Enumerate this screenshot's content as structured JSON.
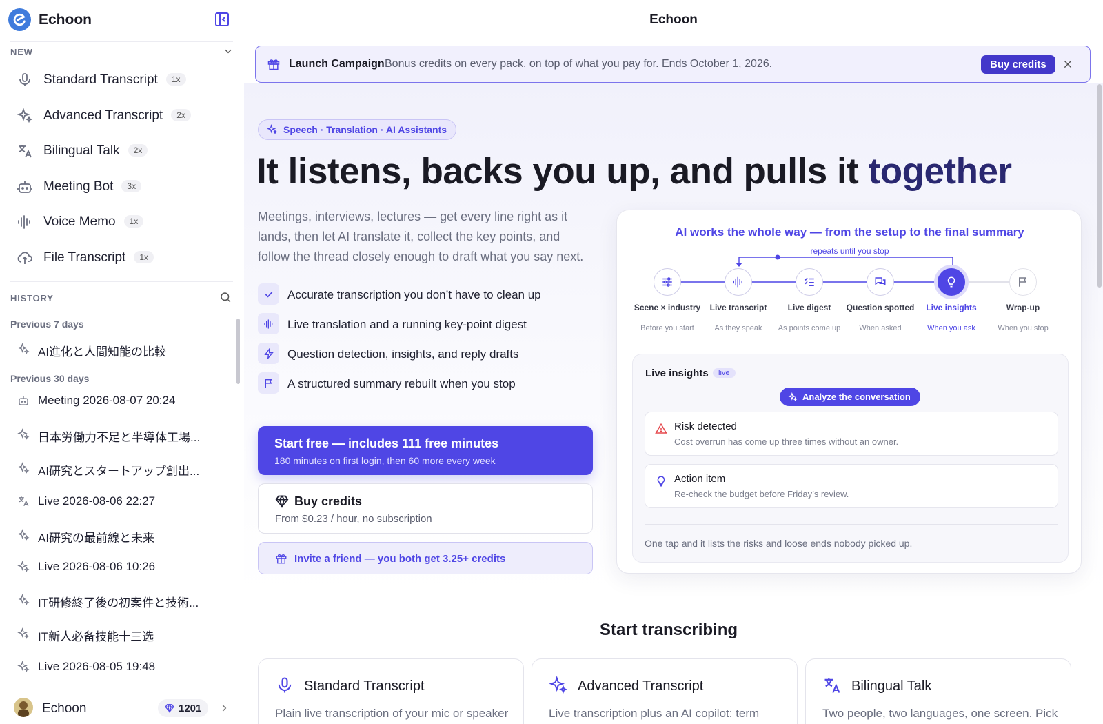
{
  "app": {
    "name": "Echoon",
    "window_title": "Echoon"
  },
  "sidebar": {
    "new_heading": "NEW",
    "modes": [
      {
        "label": "Standard Transcript",
        "multiplier": "1x",
        "icon": "mic-icon"
      },
      {
        "label": "Advanced Transcript",
        "multiplier": "2x",
        "icon": "sparkles-icon"
      },
      {
        "label": "Bilingual Talk",
        "multiplier": "2x",
        "icon": "translate-icon"
      },
      {
        "label": "Meeting Bot",
        "multiplier": "3x",
        "icon": "bot-icon"
      },
      {
        "label": "Voice Memo",
        "multiplier": "1x",
        "icon": "waveform-icon"
      },
      {
        "label": "File Transcript",
        "multiplier": "1x",
        "icon": "cloud-upload-icon"
      }
    ],
    "history_heading": "HISTORY",
    "history_groups": [
      {
        "label": "Previous 7 days"
      },
      {
        "label": "Previous 30 days"
      }
    ],
    "history": [
      {
        "label": "AI進化と人間知能の比較",
        "icon": "sparkles-icon"
      },
      {
        "label": "Meeting 2026-08-07 20:24",
        "icon": "bot-icon"
      },
      {
        "label": "日本労働力不足と半導体工場...",
        "icon": "sparkles-icon"
      },
      {
        "label": "AI研究とスタートアップ創出...",
        "icon": "sparkles-icon"
      },
      {
        "label": "Live 2026-08-06 22:27",
        "icon": "translate-icon"
      },
      {
        "label": "AI研究の最前線と未来",
        "icon": "sparkles-icon"
      },
      {
        "label": "Live 2026-08-06 10:26",
        "icon": "sparkles-icon"
      },
      {
        "label": "IT研修終了後の初案件と技術...",
        "icon": "sparkles-icon"
      },
      {
        "label": "IT新人必备技能十三选",
        "icon": "sparkles-icon"
      },
      {
        "label": "Live 2026-08-05 19:48",
        "icon": "sparkles-icon"
      }
    ],
    "user": {
      "name": "Echoon",
      "credits": "1201"
    }
  },
  "main": {
    "title": "Echoon",
    "banner": {
      "title": "Launch Campaign",
      "text": "Bonus credits on every pack, on top of what you pay for. Ends October 1, 2026.",
      "button": "Buy credits"
    },
    "hero": {
      "pill": "Speech · Translation · AI Assistants",
      "title_main": "It listens, backs you up, and pulls it ",
      "title_highlight": "together",
      "description": "Meetings, interviews, lectures — get every line right as it lands, then let AI translate it, collect the key points, and follow the thread closely enough to draft what you say next.",
      "features": [
        {
          "text": "Accurate transcription you don’t have to clean up",
          "icon": "check-icon"
        },
        {
          "text": "Live translation and a running key-point digest",
          "icon": "waveform-icon"
        },
        {
          "text": "Question detection, insights, and reply drafts",
          "icon": "bolt-icon"
        },
        {
          "text": "A structured summary rebuilt when you stop",
          "icon": "flag-icon"
        }
      ],
      "cta_primary_title": "Start free — includes 111 free minutes",
      "cta_primary_sub": "180 minutes on first login, then 60 more every week",
      "cta_buy_title": "Buy credits",
      "cta_buy_sub": "From $0.23 / hour, no subscription",
      "cta_invite": "Invite a friend — you both get 3.25+ credits"
    },
    "workflow": {
      "title": "AI works the whole way — from the setup to the final summary",
      "repeat_label": "repeats until you stop",
      "steps": [
        {
          "label": "Scene × industry",
          "when": "Before you start",
          "icon": "sliders-icon"
        },
        {
          "label": "Live transcript",
          "when": "As they speak",
          "icon": "waveform-icon"
        },
        {
          "label": "Live digest",
          "when": "As points come up",
          "icon": "checklist-icon"
        },
        {
          "label": "Question spotted",
          "when": "When asked",
          "icon": "chat-icon"
        },
        {
          "label": "Live insights",
          "when": "When you ask",
          "icon": "lightbulb-icon",
          "active": true
        },
        {
          "label": "Wrap-up",
          "when": "When you stop",
          "icon": "flag-icon"
        }
      ],
      "insights": {
        "title": "Live insights",
        "badge": "live",
        "button": "Analyze the conversation",
        "items": [
          {
            "title": "Risk detected",
            "desc": "Cost overrun has come up three times without an owner.",
            "icon": "warning-icon",
            "color": "#e5484d"
          },
          {
            "title": "Action item",
            "desc": "Re-check the budget before Friday’s review.",
            "icon": "lightbulb-icon",
            "color": "#4f46e5"
          }
        ],
        "footer": "One tap and it lists the risks and loose ends nobody picked up."
      }
    },
    "start_section": {
      "title": "Start transcribing",
      "cards": [
        {
          "title": "Standard Transcript",
          "desc": "Plain live transcription of your mic or speaker",
          "icon": "mic-icon"
        },
        {
          "title": "Advanced Transcript",
          "desc": "Live transcription plus an AI copilot: term",
          "icon": "sparkles-icon"
        },
        {
          "title": "Bilingual Talk",
          "desc": "Two people, two languages, one screen. Pick",
          "icon": "translate-icon"
        }
      ]
    }
  },
  "colors": {
    "accent": "#4f46e5",
    "accent_dark": "#4338ca",
    "danger": "#e5484d"
  }
}
